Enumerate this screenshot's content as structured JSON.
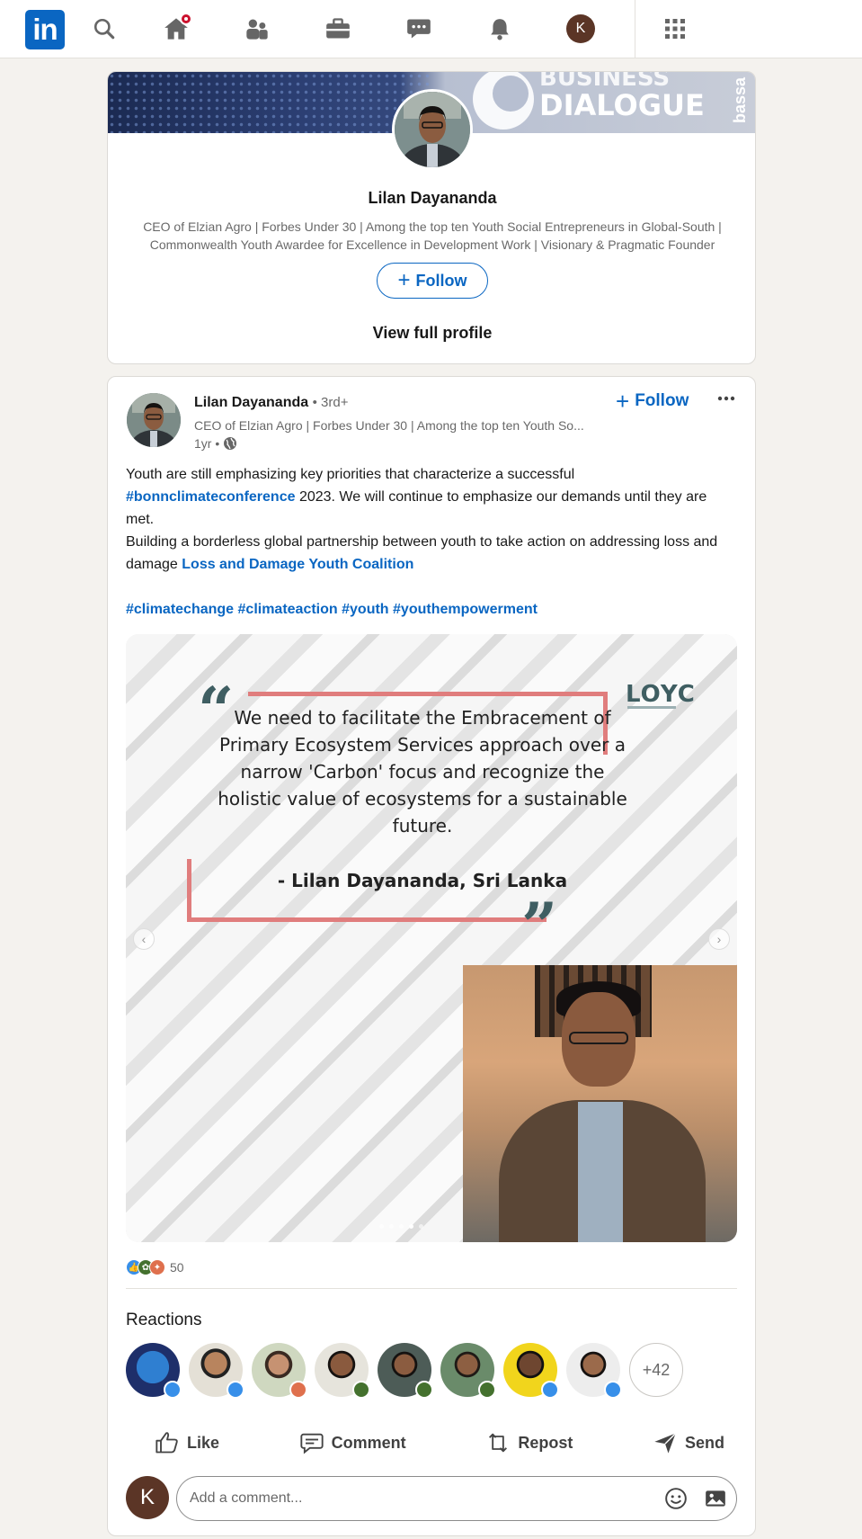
{
  "nav": {
    "logo_text": "in",
    "avatar_initial": "K",
    "icons": [
      "search-icon",
      "home-icon",
      "people-icon",
      "briefcase-icon",
      "messaging-icon",
      "bell-icon",
      "avatar",
      "apps-grid-icon"
    ],
    "brand_color": "#0a66c2"
  },
  "profile_card": {
    "banner_line1": "BUSINESS",
    "banner_line2": "DIALOGUE",
    "banner_side": "bassa",
    "name": "Lilan Dayananda",
    "headline_line1": "CEO of Elzian Agro | Forbes Under 30 | Among the top ten Youth Social Entrepreneurs in Global-South |",
    "headline_line2": "Commonwealth Youth Awardee for Excellence in Development Work | Visionary & Pragmatic Founder",
    "follow_label": "Follow",
    "view_profile_label": "View full profile"
  },
  "post": {
    "author": "Lilan Dayananda",
    "degree": "• 3rd+",
    "headline": "CEO of Elzian Agro | Forbes Under 30 | Among the top ten Youth So...",
    "time": "1yr •",
    "follow_label": "Follow",
    "body_part1": "Youth are still emphasizing key priorities that characterize a successful",
    "hashtag_bonn": "#bonnclimateconference",
    "body_part2": " 2023. We will continue to emphasize our demands until they are met.",
    "body_part3": "Building a borderless global partnership between youth to take action on addressing loss and damage ",
    "mention": "Loss and Damage Youth Coalition",
    "hashtags": [
      "#climatechange",
      "#climateaction",
      "#youth",
      "#youthempowerment"
    ],
    "image": {
      "quote": "We need to facilitate the Embracement of Primary Ecosystem Services approach over a narrow 'Carbon' focus and recognize the holistic value of ecosystems for a sustainable future.",
      "attribution": "-  Lilan Dayananda, Sri Lanka",
      "logo": "LOYC",
      "accent_color": "#e07d7d",
      "carousel_pages": 5,
      "carousel_active_index": 3
    },
    "reaction_count": "50",
    "reactions_title": "Reactions",
    "reactions_more": "+42",
    "actions": {
      "like": "Like",
      "comment": "Comment",
      "repost": "Repost",
      "send": "Send"
    },
    "comment_placeholder": "Add a comment..."
  }
}
